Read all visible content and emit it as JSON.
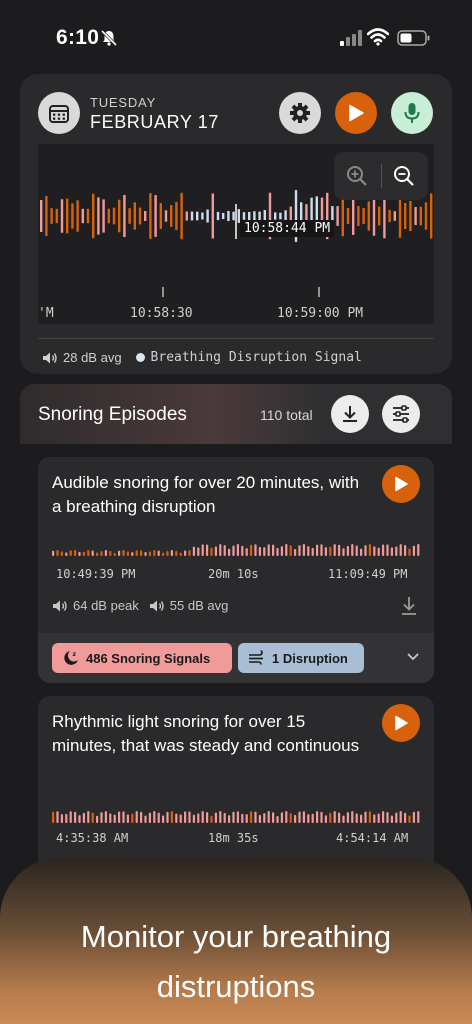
{
  "status_bar": {
    "time": "6:10"
  },
  "header": {
    "day": "TUESDAY",
    "date": "FEBRUARY 17"
  },
  "waveform": {
    "cursor_time": "10:58:44 PM",
    "axis_left_partial": "'M",
    "axis_ticks": [
      "10:58:30",
      "10:59:00 PM"
    ]
  },
  "legend": {
    "avg": "28 dB avg",
    "signal": "Breathing Disruption Signal"
  },
  "episodes_header": {
    "title": "Snoring Episodes",
    "total": "110 total"
  },
  "episodes": [
    {
      "description": "Audible snoring for over 20 minutes, with a breathing disruption",
      "start": "10:49:39 PM",
      "duration": "20m 10s",
      "end": "11:09:49 PM",
      "peak": "64 dB peak",
      "avg": "55 dB avg",
      "snoring_signals": "486 Snoring Signals",
      "disruptions": "1 Disruption"
    },
    {
      "description": "Rhythmic light snoring for over 15 minutes, that was steady and continuous",
      "start": "4:35:38 AM",
      "duration": "18m 35s",
      "end": "4:54:14 AM"
    }
  ],
  "banner": {
    "line1": "Monitor your breathing",
    "line2": "distruptions"
  },
  "colors": {
    "accent": "#d8620b",
    "snore": "#f09a9a",
    "disruption": "#a9bdd4",
    "mic": "#c9eed8"
  }
}
